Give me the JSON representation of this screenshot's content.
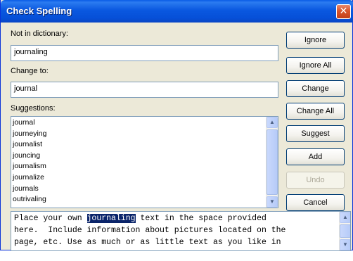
{
  "window": {
    "title": "Check Spelling",
    "close_glyph": "✕"
  },
  "fields": {
    "not_in_dictionary_label": "Not in dictionary:",
    "not_in_dictionary_value": "journaling",
    "change_to_label": "Change to:",
    "change_to_value": "journal",
    "suggestions_label": "Suggestions:"
  },
  "suggestions": [
    "journal",
    "journeying",
    "journalist",
    "jouncing",
    "journalism",
    "journalize",
    "journals",
    "outrivaling"
  ],
  "buttons": {
    "ignore": "Ignore",
    "ignore_all": "Ignore All",
    "change": "Change",
    "change_all": "Change All",
    "suggest": "Suggest",
    "add": "Add",
    "undo": "Undo",
    "cancel": "Cancel"
  },
  "context": {
    "line1_before": "Place your own ",
    "line1_highlight": "journaling",
    "line1_after": " text in the space provided",
    "line2": "here.  Include information about pictures located on the",
    "line3": "page, etc. Use as much or as little text as you like in"
  },
  "icons": {
    "scroll_up": "▲",
    "scroll_down": "▼"
  },
  "colors": {
    "titlebar": "#0a58e0",
    "highlight": "#0a246a",
    "dialog_bg": "#ece9d8"
  }
}
